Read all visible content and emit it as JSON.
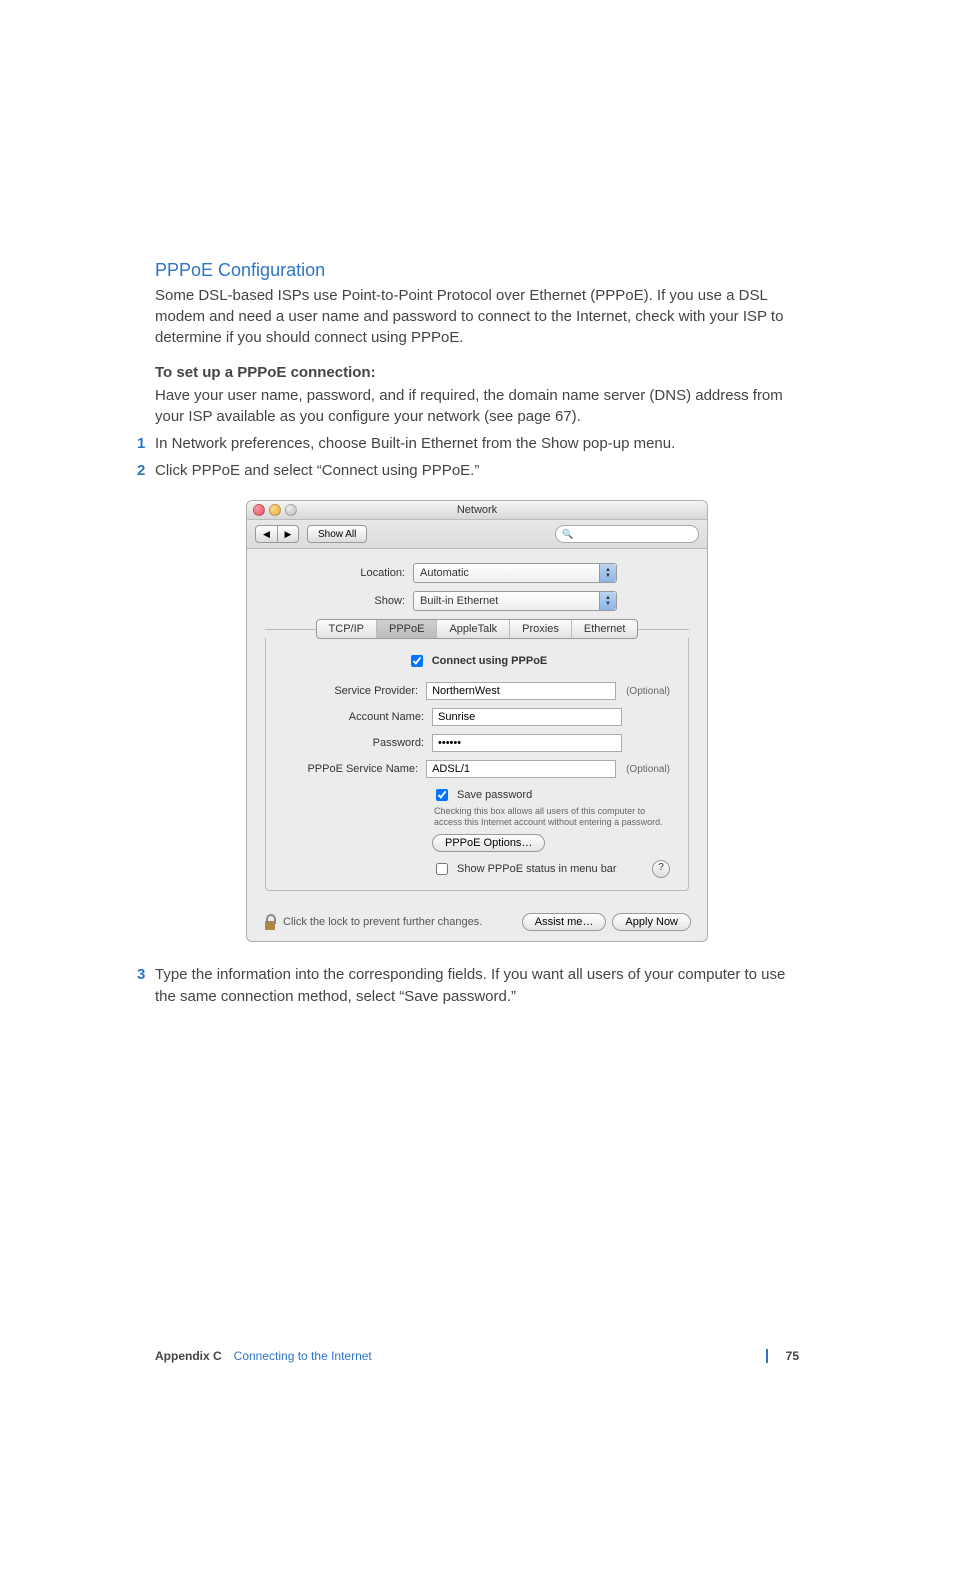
{
  "section": {
    "title": "PPPoE Configuration",
    "intro": "Some DSL-based ISPs use Point-to-Point Protocol over Ethernet (PPPoE). If you use a DSL modem and need a user name and password to connect to the Internet, check with your ISP to determine if you should connect using PPPoE.",
    "howto_heading": "To set up a PPPoE connection:",
    "howto_body": "Have your user name, password, and if required, the domain name server (DNS) address from your ISP available as you configure your network (see page 67).",
    "steps": [
      "In Network preferences, choose Built-in Ethernet from the Show pop-up menu.",
      "Click PPPoE and select “Connect using PPPoE.”"
    ],
    "step3": "Type the information into the corresponding fields. If you want all users of your computer to use the same connection method, select “Save password.”"
  },
  "window": {
    "title": "Network",
    "nav_back": "◀",
    "nav_fwd": "▶",
    "show_all": "Show All",
    "search_placeholder": "",
    "search_icon": "🔍",
    "location_label": "Location:",
    "location_value": "Automatic",
    "show_label": "Show:",
    "show_value": "Built-in Ethernet",
    "tabs": [
      "TCP/IP",
      "PPPoE",
      "AppleTalk",
      "Proxies",
      "Ethernet"
    ],
    "active_tab": 1,
    "connect_label": "Connect using PPPoE",
    "connect_checked": true,
    "fields": {
      "service_provider_label": "Service Provider:",
      "service_provider_value": "NorthernWest",
      "service_provider_optional": "(Optional)",
      "account_name_label": "Account Name:",
      "account_name_value": "Sunrise",
      "password_label": "Password:",
      "password_value": "••••••",
      "pppoe_service_label": "PPPoE Service Name:",
      "pppoe_service_value": "ADSL/1",
      "pppoe_service_optional": "(Optional)"
    },
    "save_password_label": "Save password",
    "save_password_checked": true,
    "save_password_hint": "Checking this box allows all users of this computer to access this Internet account without entering a password.",
    "options_button": "PPPoE Options…",
    "menubar_label": "Show PPPoE status in menu bar",
    "menubar_checked": false,
    "help": "?",
    "lock_text": "Click the lock to prevent further changes.",
    "assist_button": "Assist me…",
    "apply_button": "Apply Now"
  },
  "footer": {
    "appendix": "Appendix C",
    "chapter": "Connecting to the Internet",
    "page": "75"
  }
}
